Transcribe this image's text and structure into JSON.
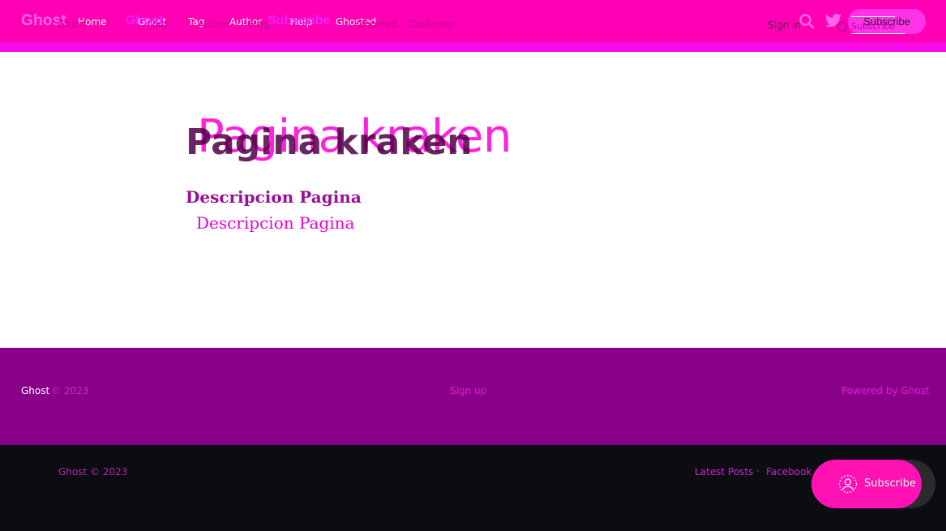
{
  "header": {
    "logo": "Ghost",
    "nav_primary": [
      "Home",
      "Ghost",
      "Tag",
      "Author",
      "Help",
      "Ghosted"
    ],
    "nav_secondary": [
      "Ghost",
      "Tag",
      "Author",
      "Help",
      "Ghosted",
      "Customer"
    ],
    "nav_overlay": [
      "Ghost",
      "Subscribe"
    ],
    "sign_in": "Sign in",
    "subscribe": "Subscribe",
    "subscribe_ghost": "Subscribe"
  },
  "page": {
    "title": "Pagina kraken",
    "description": "Descripcion Pagina"
  },
  "footer_primary": {
    "site": "Ghost",
    "copyright": "© 2023",
    "signup": "Sign up",
    "powered_by": "Powered by Ghost"
  },
  "footer_secondary": {
    "copyright": "Ghost © 2023",
    "links": [
      "Latest Posts",
      "Facebook"
    ],
    "separator": "·"
  },
  "portal_button": {
    "label": "Subscribe"
  },
  "colors": {
    "accent": "#ff00b4",
    "footer_primary_bg": "#880088",
    "footer_secondary_bg": "#0c0d10"
  }
}
